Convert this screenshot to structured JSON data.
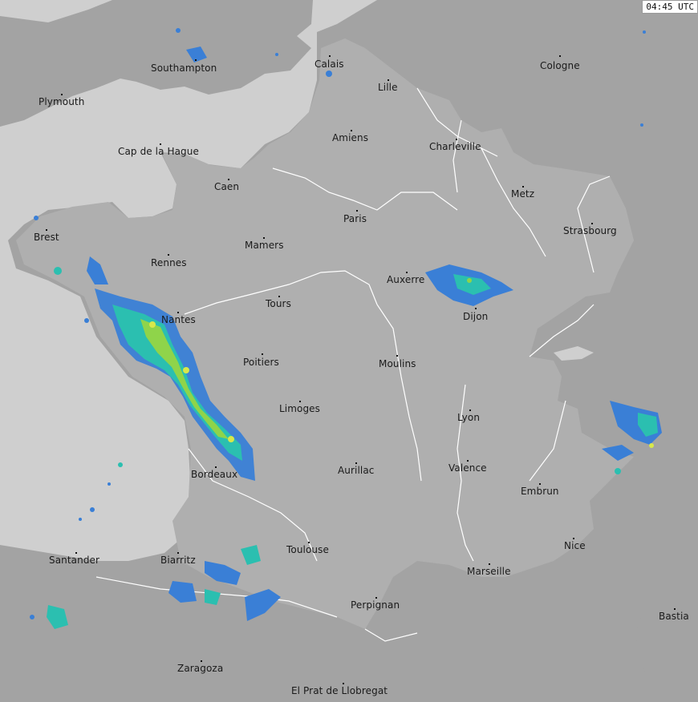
{
  "timestamp": "04:45 UTC",
  "colors": {
    "sea": "#cfcfcf",
    "land_france": "#afafaf",
    "land_other": "#a3a3a3",
    "rivers_borders": "#ffffff",
    "radar_light": "#3a7fd6",
    "radar_mid": "#2bbfb0",
    "radar_heavy": "#d8e84a"
  },
  "cities": [
    {
      "name": "Southampton"
    },
    {
      "name": "Calais"
    },
    {
      "name": "Cologne"
    },
    {
      "name": "Plymouth"
    },
    {
      "name": "Lille"
    },
    {
      "name": "Amiens"
    },
    {
      "name": "Charleville"
    },
    {
      "name": "Cap de la Hague"
    },
    {
      "name": "Caen"
    },
    {
      "name": "Metz"
    },
    {
      "name": "Paris"
    },
    {
      "name": "Strasbourg"
    },
    {
      "name": "Brest"
    },
    {
      "name": "Mamers"
    },
    {
      "name": "Rennes"
    },
    {
      "name": "Auxerre"
    },
    {
      "name": "Tours"
    },
    {
      "name": "Dijon"
    },
    {
      "name": "Nantes"
    },
    {
      "name": "Poitiers"
    },
    {
      "name": "Moulins"
    },
    {
      "name": "Limoges"
    },
    {
      "name": "Lyon"
    },
    {
      "name": "Bordeaux"
    },
    {
      "name": "Valence"
    },
    {
      "name": "Aurillac"
    },
    {
      "name": "Embrun"
    },
    {
      "name": "Toulouse"
    },
    {
      "name": "Nice"
    },
    {
      "name": "Santander"
    },
    {
      "name": "Biarritz"
    },
    {
      "name": "Marseille"
    },
    {
      "name": "Perpignan"
    },
    {
      "name": "Bastia"
    },
    {
      "name": "Zaragoza"
    },
    {
      "name": "El Prat de Llobregat"
    }
  ]
}
